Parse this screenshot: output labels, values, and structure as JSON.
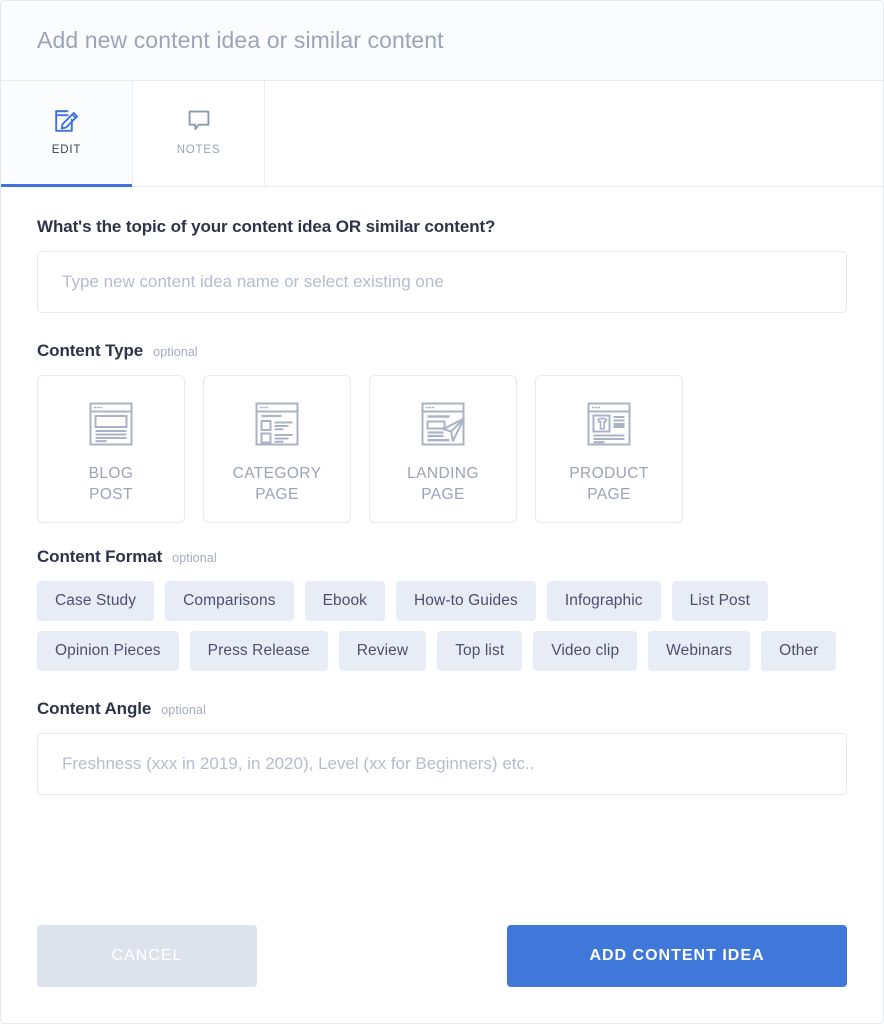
{
  "header": {
    "title": "Add new content idea or similar content"
  },
  "tabs": [
    {
      "label": "EDIT",
      "icon": "edit-pencil-icon",
      "active": true
    },
    {
      "label": "NOTES",
      "icon": "speech-bubble-icon",
      "active": false
    }
  ],
  "topic": {
    "label": "What's the topic of your content idea OR similar content?",
    "placeholder": "Type new content idea name or select existing one",
    "value": ""
  },
  "content_type": {
    "label": "Content Type",
    "optional": "optional",
    "cards": [
      {
        "label": "BLOG\nPOST",
        "icon": "blog-post-icon"
      },
      {
        "label": "CATEGORY\nPAGE",
        "icon": "category-page-icon"
      },
      {
        "label": "LANDING\nPAGE",
        "icon": "landing-page-icon"
      },
      {
        "label": "PRODUCT\nPAGE",
        "icon": "product-page-icon"
      }
    ]
  },
  "content_format": {
    "label": "Content Format",
    "optional": "optional",
    "chips": [
      "Case Study",
      "Comparisons",
      "Ebook",
      "How-to Guides",
      "Infographic",
      "List Post",
      "Opinion Pieces",
      "Press Release",
      "Review",
      "Top list",
      "Video clip",
      "Webinars",
      "Other"
    ]
  },
  "content_angle": {
    "label": "Content Angle",
    "optional": "optional",
    "placeholder": "Freshness (xxx in 2019, in 2020), Level (xx for Beginners) etc..",
    "value": ""
  },
  "footer": {
    "cancel_label": "CANCEL",
    "submit_label": "ADD CONTENT IDEA"
  },
  "colors": {
    "accent": "#4078da",
    "chip_bg": "#e7ecf6",
    "muted_text": "#9aa3b8",
    "cancel_bg": "#dde3ed",
    "border": "#e6eaf2"
  }
}
